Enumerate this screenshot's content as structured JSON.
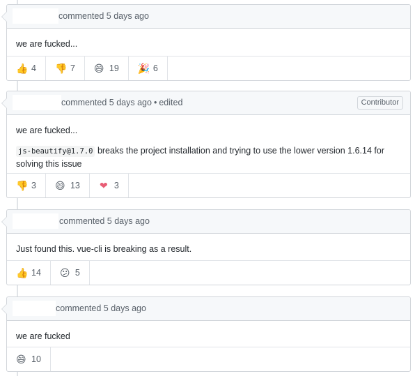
{
  "comments": [
    {
      "header_text": "commented 5 days ago",
      "edited": "",
      "badge": "",
      "body": [
        "we are fucked..."
      ],
      "reactions": [
        {
          "icon": "thumbs-up-icon",
          "glyph": "👍",
          "count": "4"
        },
        {
          "icon": "thumbs-down-icon",
          "glyph": "👎",
          "count": "7"
        },
        {
          "icon": "laugh-icon",
          "glyph": "😄",
          "count": "19"
        },
        {
          "icon": "tada-icon",
          "glyph": "🎉",
          "count": "6"
        }
      ]
    },
    {
      "header_text": "commented 5 days ago",
      "edited": "edited",
      "badge": "Contributor",
      "body": [
        "we are fucked..."
      ],
      "code": "js-beautify@1.7.0",
      "body_after_code": " breaks the project installation and trying to use the lower version 1.6.14 for solving this issue",
      "reactions": [
        {
          "icon": "thumbs-down-icon",
          "glyph": "👎",
          "count": "3"
        },
        {
          "icon": "laugh-icon",
          "glyph": "😄",
          "count": "13"
        },
        {
          "icon": "heart-icon",
          "glyph": "❤",
          "count": "3"
        }
      ]
    },
    {
      "header_text": "commented 5 days ago",
      "edited": "",
      "badge": "",
      "body": [
        "Just found this. vue-cli is breaking as a result."
      ],
      "reactions": [
        {
          "icon": "thumbs-up-icon",
          "glyph": "👍",
          "count": "14"
        },
        {
          "icon": "confused-icon",
          "glyph": "😕",
          "count": "5"
        }
      ]
    },
    {
      "header_text": "commented 5 days ago",
      "edited": "",
      "badge": "",
      "body": [
        "we are fucked"
      ],
      "reactions": [
        {
          "icon": "laugh-icon",
          "glyph": "😄",
          "count": "10"
        }
      ]
    }
  ],
  "colors": {
    "header_bg": "#f6f8fa",
    "border": "#d1d5da",
    "muted_text": "#586069",
    "reaction_yellow": "#f0b429",
    "heart": "#e85d75"
  }
}
